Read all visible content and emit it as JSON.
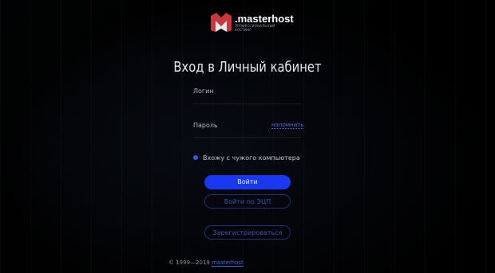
{
  "logo": {
    "name": ".masterhost",
    "tagline": "ПРОФЕССИОНАЛЬНЫЙ ХОСТИНГ",
    "icon": "masterhost-m-icon"
  },
  "page": {
    "title": "Вход в Личный кабинет"
  },
  "form": {
    "login_label": "Логин",
    "password_label": "Пароль",
    "remind_link": "напомнить",
    "foreign_computer_label": "Вхожу с чужого компьютера",
    "login_button": "Войти",
    "eds_button": "Войти по ЭЦП",
    "register_button": "Зарегистрироваться"
  },
  "footer": {
    "copyright": "© 1999—2019",
    "brand": "masterhost"
  },
  "colors": {
    "accent": "#1839f0",
    "link": "#4a6fe0",
    "background": "#000000"
  }
}
